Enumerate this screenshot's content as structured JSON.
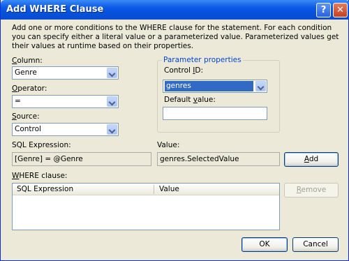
{
  "window": {
    "title": "Add WHERE Clause",
    "help_glyph": "?",
    "close_glyph": "✕"
  },
  "description": "Add one or more conditions to the WHERE clause for the statement. For each condition you can specify either a literal value or a parameterized value. Parameterized values get their values at runtime based on their properties.",
  "column": {
    "label_mnemonic": "C",
    "label_rest": "olumn:",
    "value": "Genre"
  },
  "operator": {
    "label_mnemonic": "O",
    "label_rest": "perator:",
    "value": "="
  },
  "source": {
    "label_mnemonic": "S",
    "label_rest": "ource:",
    "value": "Control"
  },
  "parameter_properties": {
    "legend": "Parameter properties",
    "control_id": {
      "label_pre": "Control ",
      "label_mnemonic": "I",
      "label_post": "D:",
      "value": "genres"
    },
    "default_value": {
      "label_pre": "Default ",
      "label_mnemonic": "v",
      "label_post": "alue:",
      "value": ""
    }
  },
  "sql_expression": {
    "label": "SQL Expression:",
    "value": "[Genre] = @Genre"
  },
  "value_field": {
    "label": "Value:",
    "value": "genres.SelectedValue"
  },
  "add_button": {
    "mnemonic": "A",
    "rest": "dd"
  },
  "where_clause": {
    "label_mnemonic": "W",
    "label_rest": "HERE clause:",
    "columns": [
      "SQL Expression",
      "Value"
    ]
  },
  "remove_button": {
    "mnemonic": "R",
    "rest": "emove"
  },
  "ok_button": "OK",
  "cancel_button": "Cancel"
}
